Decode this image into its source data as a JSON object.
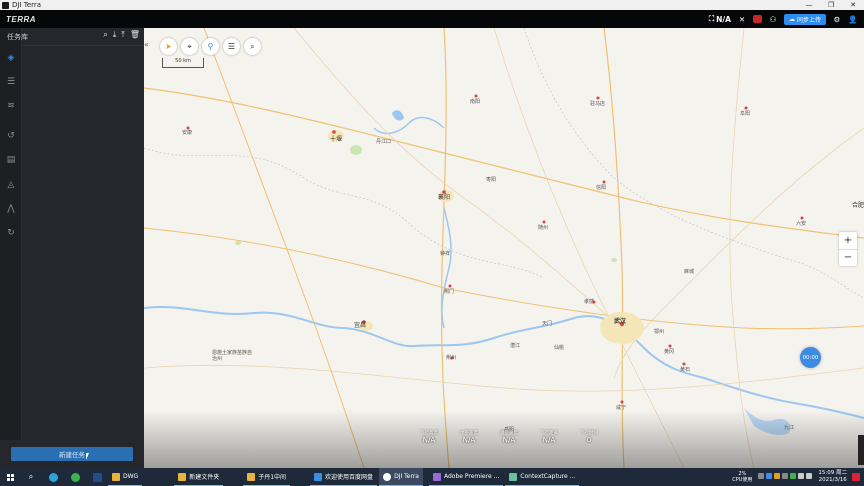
{
  "window": {
    "title": "DJI Terra",
    "controls": [
      "—",
      "❐",
      "✕"
    ]
  },
  "header": {
    "logo": "TERRA",
    "signal_value": "N/A",
    "upload_label": "同步上传"
  },
  "sidebar": {
    "panel_title": "任务库",
    "items": [
      "layers",
      "model",
      "mission",
      "waypoint",
      "mapping",
      "oblique",
      "corridor",
      "refresh"
    ],
    "new_mission_label": "新建任务"
  },
  "map": {
    "scale_label": "50 km",
    "zoom_in": "+",
    "zoom_out": "−",
    "timer": "00:00",
    "telemetry": [
      {
        "label": "飞行高度",
        "value": "N/A"
      },
      {
        "label": "水平速度",
        "value": "N/A"
      },
      {
        "label": "垂直速度",
        "value": "N/A"
      },
      {
        "label": "飞行距离",
        "value": "N/A"
      },
      {
        "label": "飞行时间",
        "value": "0"
      }
    ],
    "cities": [
      {
        "name": "十堰",
        "major": true
      },
      {
        "name": "襄阳",
        "major": true
      },
      {
        "name": "宜昌",
        "major": true
      },
      {
        "name": "武汉",
        "major": true
      },
      {
        "name": "荆门",
        "major": false
      },
      {
        "name": "荆州",
        "major": false
      },
      {
        "name": "孝感",
        "major": false
      },
      {
        "name": "随州",
        "major": false
      },
      {
        "name": "信阳",
        "major": false
      },
      {
        "name": "南阳",
        "major": false
      },
      {
        "name": "驻马店",
        "major": false
      },
      {
        "name": "黄冈",
        "major": false
      },
      {
        "name": "黄石",
        "major": false
      },
      {
        "name": "咸宁",
        "major": false
      },
      {
        "name": "安康",
        "major": false
      },
      {
        "name": "六安",
        "major": false
      },
      {
        "name": "恩施土家族苗族自治州",
        "major": false
      },
      {
        "name": "阜阳",
        "major": false
      },
      {
        "name": "丹江口",
        "major": false
      },
      {
        "name": "天门",
        "major": false
      },
      {
        "name": "仙桃",
        "major": false
      },
      {
        "name": "潜江",
        "major": false
      },
      {
        "name": "鄂州",
        "major": false
      },
      {
        "name": "麻城",
        "major": false
      },
      {
        "name": "枣阳",
        "major": false
      },
      {
        "name": "钟祥",
        "major": false
      },
      {
        "name": "岳阳",
        "major": false
      },
      {
        "name": "九江",
        "major": false
      },
      {
        "name": "合肥",
        "major": false
      }
    ]
  },
  "taskbar": {
    "apps": [
      {
        "label": "DWG",
        "color": "#e8b43a"
      },
      {
        "label": "新建文件夹",
        "color": "#e8b43a"
      },
      {
        "label": "子丹1中间",
        "color": "#e8b43a"
      },
      {
        "label": "欢迎使用百度网盘",
        "color": "#3a8ee8"
      },
      {
        "label": "DJI Terra",
        "color": "#ffffff"
      },
      {
        "label": "Adobe Premiere ...",
        "color": "#9a6ad8"
      },
      {
        "label": "ContextCapture ...",
        "color": "#6ac0a0"
      }
    ],
    "cpu_percent": "2%",
    "cpu_label": "CPU使用",
    "time": "15:09 周二",
    "date": "2021/3/16"
  },
  "colors": {
    "accent": "#2d8cf0",
    "panel": "#24272b",
    "rail": "#1d1f22",
    "map_bg": "#f5f3ee",
    "road": "#f0c070",
    "river": "#9cc7f0"
  }
}
